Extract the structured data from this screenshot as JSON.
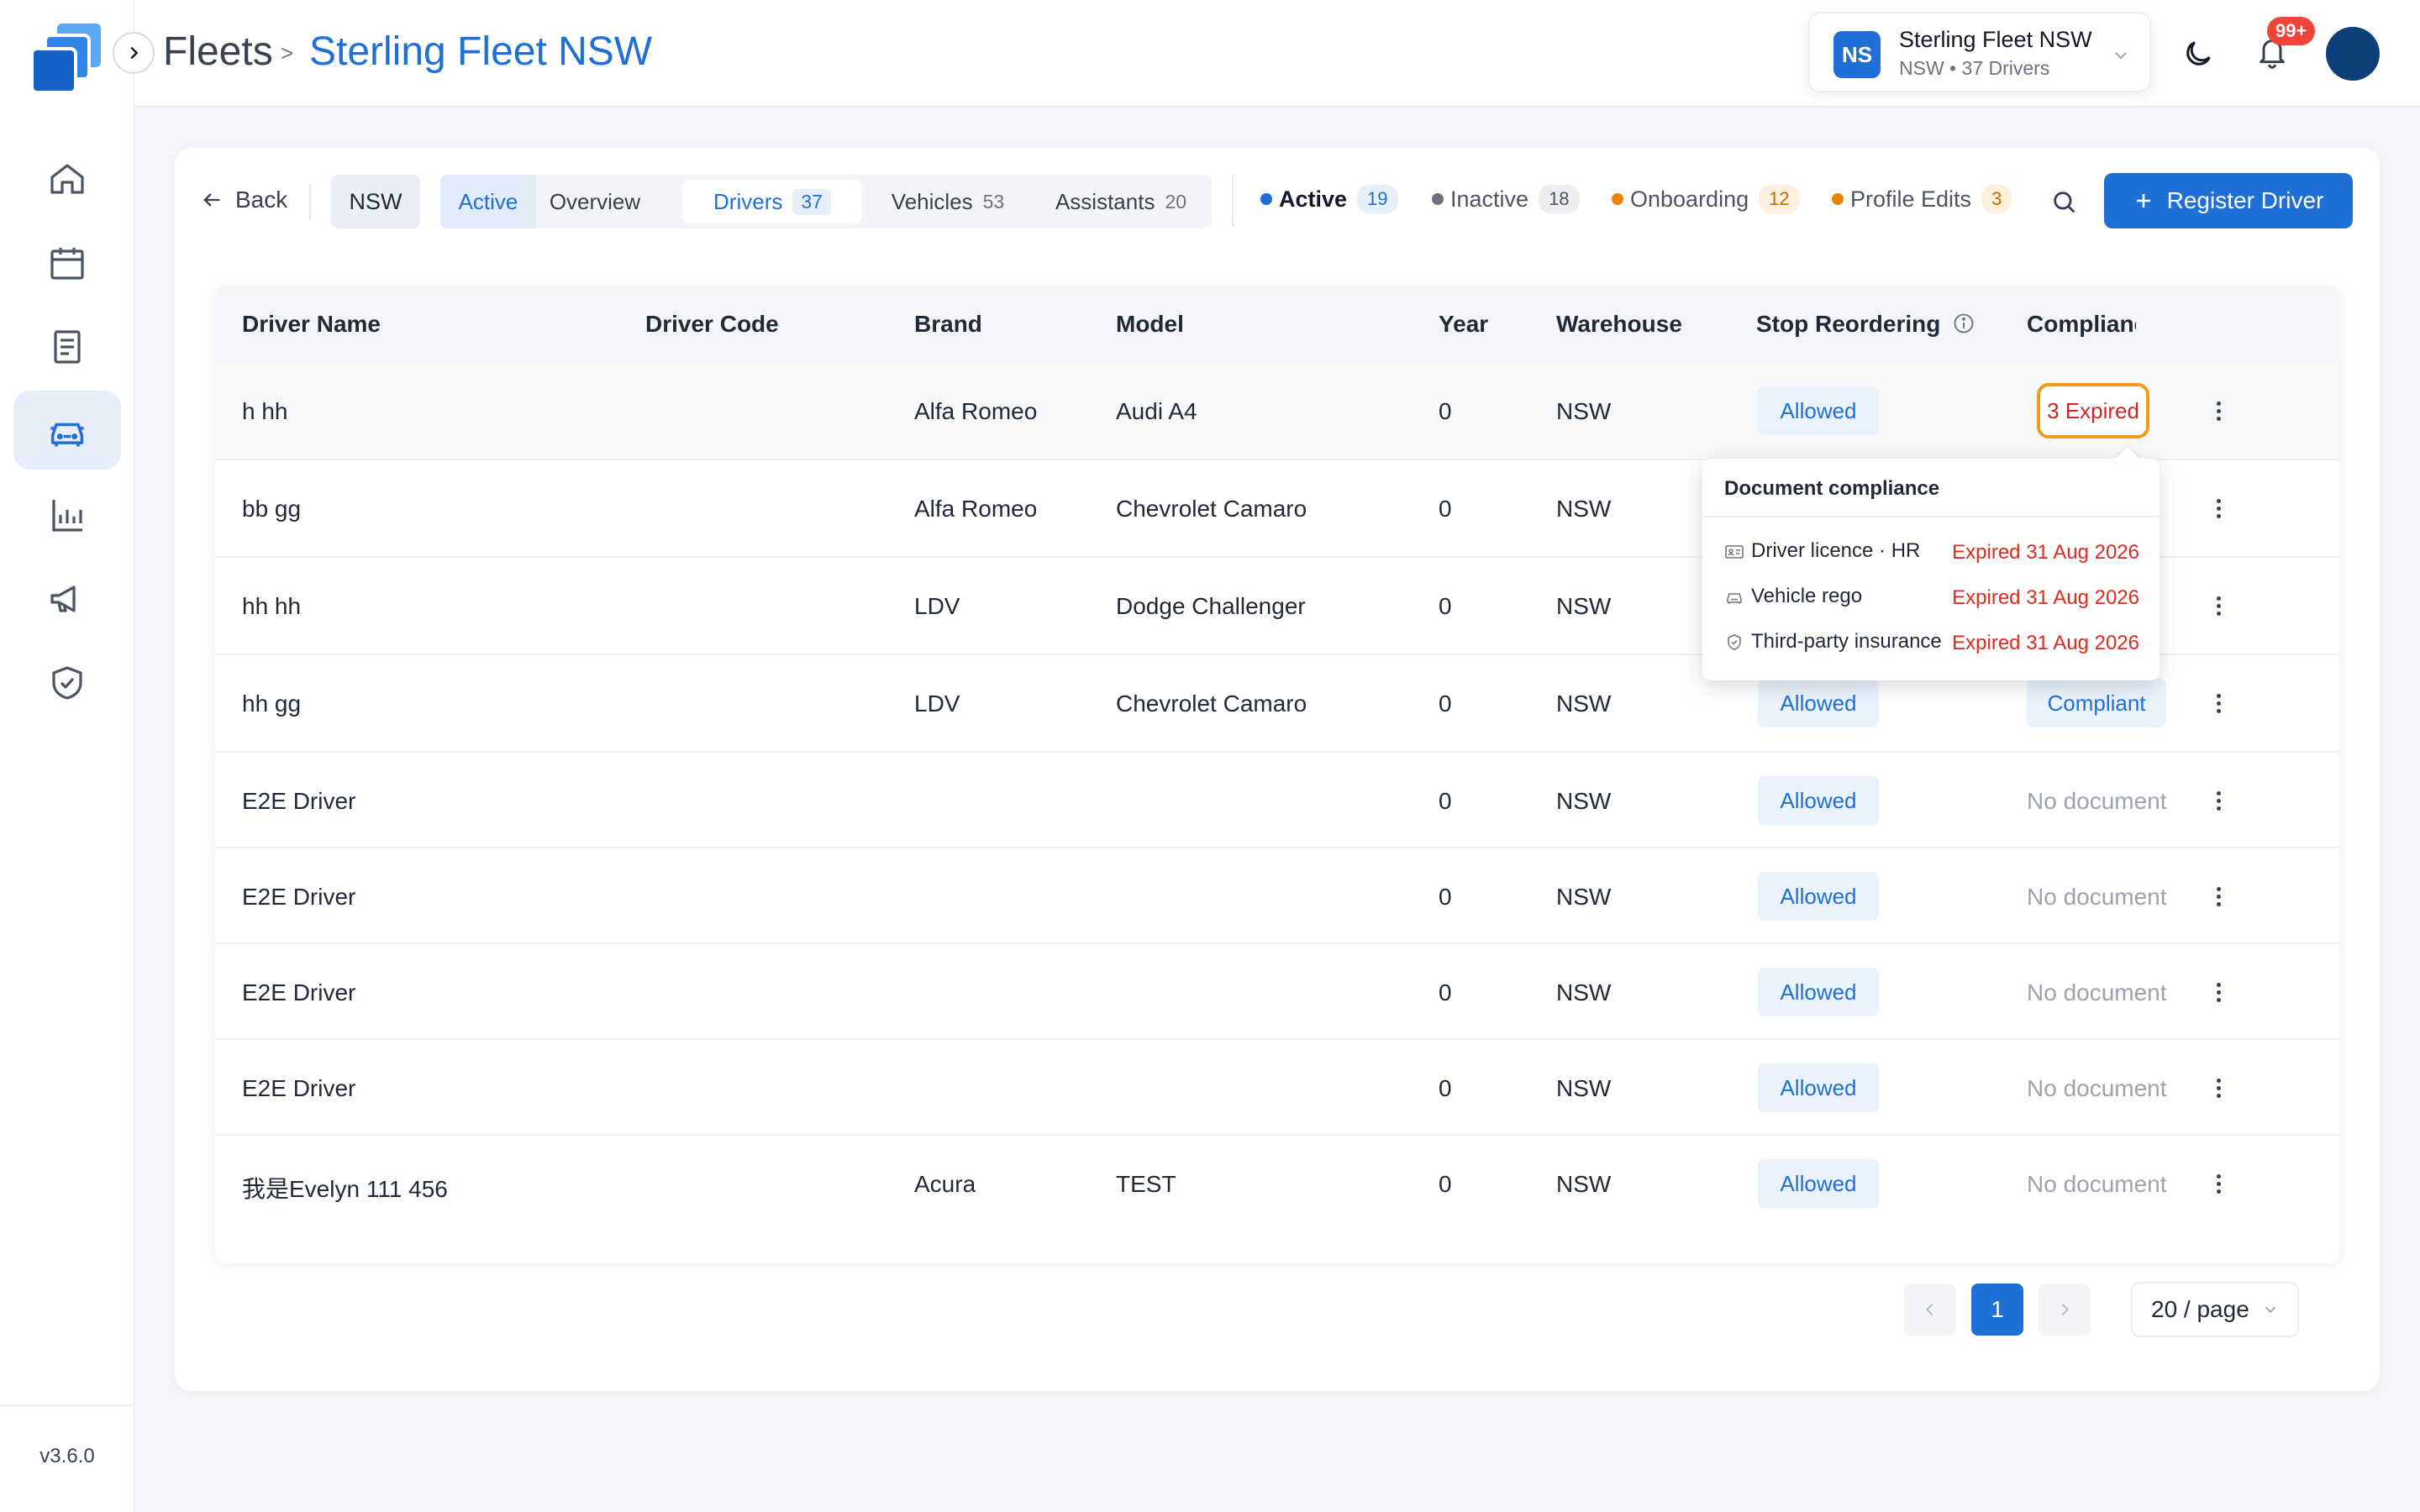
{
  "app": {
    "version": "v3.6.0"
  },
  "breadcrumb": {
    "root": "Fleets",
    "separator": ">",
    "current": "Sterling Fleet NSW"
  },
  "fleet_selector": {
    "initials": "NS",
    "name": "Sterling Fleet NSW",
    "subtitle": "NSW • 37 Drivers"
  },
  "notifications": {
    "badge": "99+"
  },
  "toolbar": {
    "back_label": "Back",
    "region_chip": "NSW",
    "tabs": [
      {
        "label": "Active",
        "count": ""
      },
      {
        "label": "Overview",
        "count": ""
      },
      {
        "label": "Drivers",
        "count": "37"
      },
      {
        "label": "Vehicles",
        "count": "53"
      },
      {
        "label": "Assistants",
        "count": "20"
      }
    ],
    "status_filters": [
      {
        "label": "Active",
        "count": "19",
        "color": "#1f6fd6"
      },
      {
        "label": "Inactive",
        "count": "18",
        "color": "#6b7280"
      },
      {
        "label": "Onboarding",
        "count": "12",
        "color": "#e8830c"
      },
      {
        "label": "Profile Edits",
        "count": "3",
        "color": "#e8830c"
      }
    ],
    "register_label": "Register Driver"
  },
  "table": {
    "columns": [
      "Driver Name",
      "Driver Code",
      "Brand",
      "Model",
      "Year",
      "Warehouse",
      "Stop Reordering",
      "Compliance S"
    ],
    "rows": [
      {
        "name": "h hh",
        "code": "",
        "brand": "Alfa Romeo",
        "model": "Audi A4",
        "year": "0",
        "warehouse": "NSW",
        "stop": "Allowed",
        "compliance": "3 Expired"
      },
      {
        "name": "bb gg",
        "code": "",
        "brand": "Alfa Romeo",
        "model": "Chevrolet Camaro",
        "year": "0",
        "warehouse": "NSW",
        "stop": "",
        "compliance": ""
      },
      {
        "name": "hh hh",
        "code": "",
        "brand": "LDV",
        "model": "Dodge Challenger",
        "year": "0",
        "warehouse": "NSW",
        "stop": "",
        "compliance": ""
      },
      {
        "name": "hh gg",
        "code": "",
        "brand": "LDV",
        "model": "Chevrolet Camaro",
        "year": "0",
        "warehouse": "NSW",
        "stop": "Allowed",
        "compliance": "Compliant"
      },
      {
        "name": "E2E Driver",
        "code": "",
        "brand": "",
        "model": "",
        "year": "0",
        "warehouse": "NSW",
        "stop": "Allowed",
        "compliance": "No document"
      },
      {
        "name": "E2E Driver",
        "code": "",
        "brand": "",
        "model": "",
        "year": "0",
        "warehouse": "NSW",
        "stop": "Allowed",
        "compliance": "No document"
      },
      {
        "name": "E2E Driver",
        "code": "",
        "brand": "",
        "model": "",
        "year": "0",
        "warehouse": "NSW",
        "stop": "Allowed",
        "compliance": "No document"
      },
      {
        "name": "E2E Driver",
        "code": "",
        "brand": "",
        "model": "",
        "year": "0",
        "warehouse": "NSW",
        "stop": "Allowed",
        "compliance": "No document"
      },
      {
        "name": "我是Evelyn 111 456",
        "code": "",
        "brand": "Acura",
        "model": "TEST",
        "year": "0",
        "warehouse": "NSW",
        "stop": "Allowed",
        "compliance": "No document"
      }
    ]
  },
  "popover": {
    "title": "Document compliance",
    "items": [
      {
        "icon": "id-card-icon",
        "label": "Driver licence · HR",
        "status": "Expired 31 Aug 2026"
      },
      {
        "icon": "car-icon",
        "label": "Vehicle rego",
        "status": "Expired 31 Aug 2026"
      },
      {
        "icon": "shield-icon",
        "label": "Third-party insurance",
        "status": "Expired 31 Aug 2026"
      }
    ]
  },
  "pagination": {
    "current_page": "1",
    "per_page": "20 / page"
  },
  "colors": {
    "primary": "#1f6fd6",
    "expired": "#d92d20",
    "warning_border": "#f29a1a"
  }
}
